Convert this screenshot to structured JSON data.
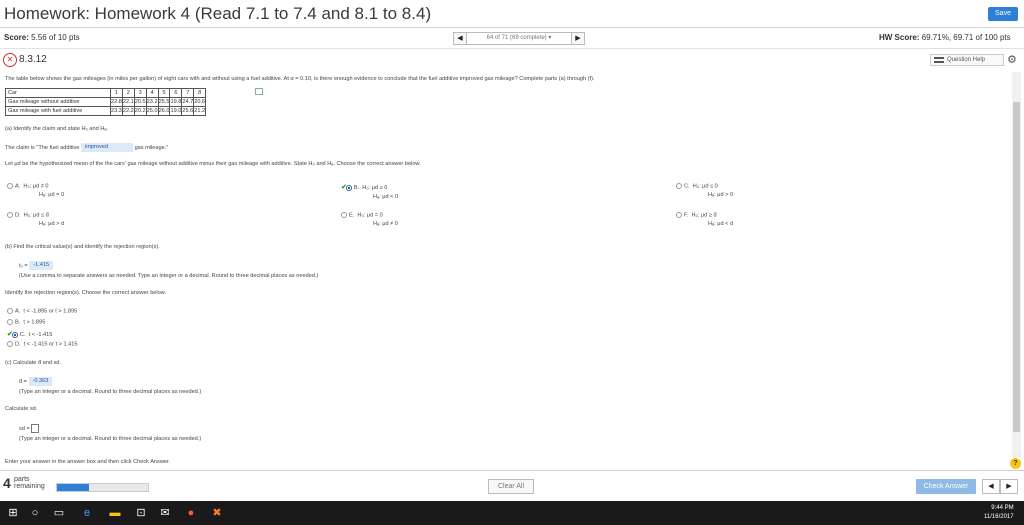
{
  "header": {
    "title": "Homework: Homework 4 (Read 7.1 to 7.4 and 8.1 to 8.4)",
    "save_label": "Save"
  },
  "score_bar": {
    "score_label": "Score:",
    "score_value": "5.56 of 10 pts",
    "progress_text": "64 of 71 (69 complete)",
    "hw_score_label": "HW Score:",
    "hw_score_value": "69.71%, 69.71 of 100 pts"
  },
  "question": {
    "number": "8.3.12",
    "help_label": "Question Help"
  },
  "problem": {
    "intro": "The table below shows the gas mileages (in miles per gallon) of eight cars with and without using a fuel additive. At α = 0.10, is there enough evidence to conclude that the fuel additive improved gas mileage? Complete parts (a) through (f).",
    "table": {
      "header_label": "Car",
      "cars": [
        "1",
        "2",
        "3",
        "4",
        "5",
        "6",
        "7",
        "8"
      ],
      "rows": [
        {
          "label": "Gas mileage without additive",
          "values": [
            "22.8",
            "22.1",
            "20.5",
            "23.2",
            "25.5",
            "19.8",
            "24.7",
            "20.6"
          ]
        },
        {
          "label": "Gas mileage with fuel additive",
          "values": [
            "23.3",
            "22.2",
            "20.2",
            "25.0",
            "26.0",
            "19.0",
            "25.6",
            "21.2"
          ]
        }
      ]
    }
  },
  "part_a": {
    "prompt": "(a) Identify the claim and state H₀ and Hₐ.",
    "claim_prefix": "The claim is \"The fuel additive",
    "claim_answer": "improved",
    "claim_suffix": "gas mileage.\"",
    "mu_text": "Let μd be the hypothesized mean of the the cars' gas mileage without additive minus their gas mileage with additive. State H₀ and Hₐ. Choose the correct answer below.",
    "options": [
      {
        "letter": "A.",
        "h0": "H₀: μd ≠ 0",
        "ha": "Hₐ: μd = 0",
        "selected": false
      },
      {
        "letter": "B.",
        "h0": "H₀: μd ≥ 0",
        "ha": "Hₐ: μd < 0",
        "selected": true
      },
      {
        "letter": "C.",
        "h0": "H₀: μd ≤ 0",
        "ha": "Hₐ: μd > 0",
        "selected": false
      },
      {
        "letter": "D.",
        "h0": "H₀: μd ≤ d̄",
        "ha": "Hₐ: μd > d",
        "selected": false
      },
      {
        "letter": "E.",
        "h0": "H₀: μd = 0",
        "ha": "Hₐ: μd ≠ 0",
        "selected": false
      },
      {
        "letter": "F.",
        "h0": "H₀: μd ≥ d̄",
        "ha": "Hₐ: μd < d",
        "selected": false
      }
    ]
  },
  "part_b": {
    "prompt": "(b) Find the critical value(s) and identify the rejection region(s).",
    "t0_label": "t₀ =",
    "t0_answer": "-1.415",
    "t0_note": "(Use a comma to separate answers as needed. Type an integer or a decimal. Round to three decimal places as needed.)",
    "region_prompt": "Identify the rejection region(s). Choose the correct answer below.",
    "options": [
      {
        "letter": "A.",
        "text": "t < -1.895 or t > 1.895",
        "selected": false
      },
      {
        "letter": "B.",
        "text": "t > 1.895",
        "selected": false
      },
      {
        "letter": "C.",
        "text": "t < -1.415",
        "selected": true
      },
      {
        "letter": "D.",
        "text": "t < -1.415 or t > 1.415",
        "selected": false
      }
    ]
  },
  "part_c": {
    "prompt": "(c) Calculate d̄ and sd.",
    "dbar_label": "d̄ =",
    "dbar_answer": "-0.363",
    "dbar_note": "(Type an integer or a decimal. Round to three decimal places as needed.)",
    "calc_sd": "Calculate sd.",
    "sd_label": "sd =",
    "sd_note": "(Type an integer or a decimal. Round to three decimal places as needed.)"
  },
  "instruction": "Enter your answer in the answer box and then click Check Answer.",
  "footer": {
    "parts_number": "4",
    "parts_label_1": "parts",
    "parts_label_2": "remaining",
    "progress_fraction": 0.35,
    "clear_all": "Clear All",
    "check_answer": "Check Answer"
  },
  "taskbar": {
    "time": "9:44 PM",
    "date": "11/16/2017"
  }
}
